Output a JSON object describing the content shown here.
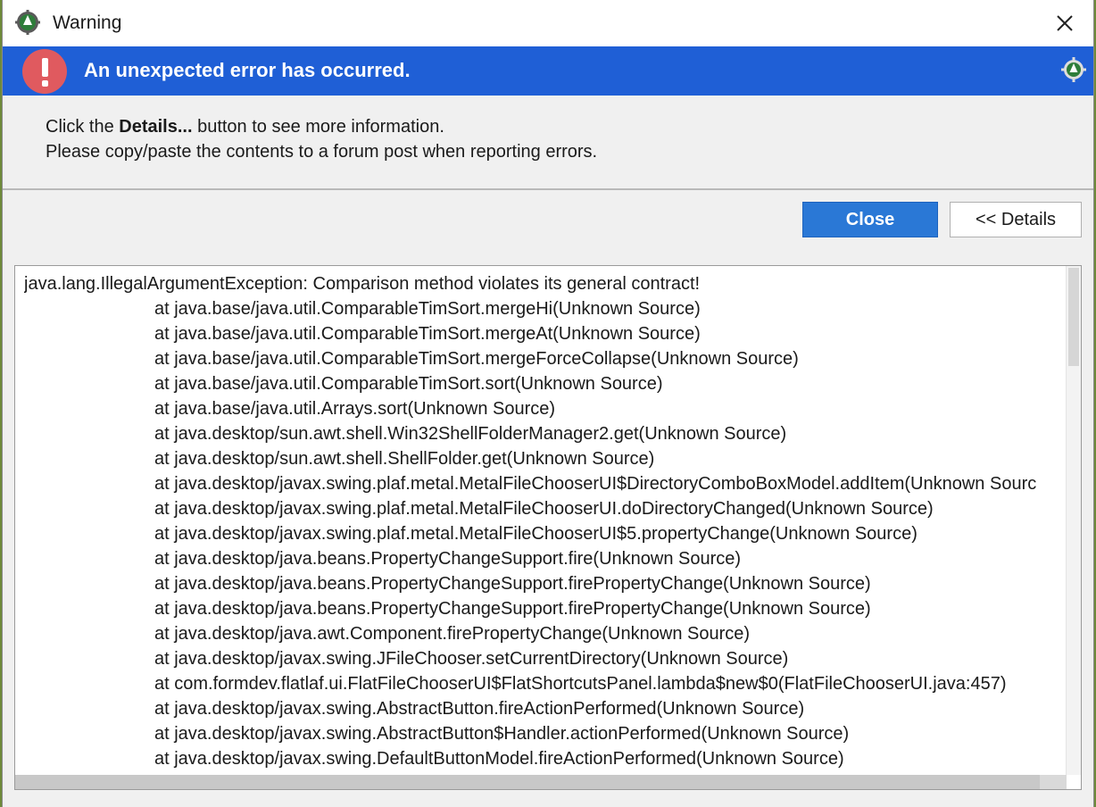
{
  "window": {
    "title": "Warning",
    "app_icon": "eclipse-gear-icon",
    "close_icon": "close-icon"
  },
  "banner": {
    "text": "An unexpected error has occurred.",
    "error_icon": "error-exclamation-icon",
    "gear_icon": "gear-icon",
    "background": "#1f5fd6",
    "icon_color": "#e05a5f"
  },
  "message": {
    "line1_prefix": "Click the ",
    "line1_bold": "Details...",
    "line1_suffix": " button to see more information.",
    "line2": "Please copy/paste the contents to a forum post when reporting errors."
  },
  "buttons": {
    "close_label": "Close",
    "details_label": "<< Details",
    "accent": "#2a78d6"
  },
  "details": {
    "header": "java.lang.IllegalArgumentException: Comparison method violates its general contract!",
    "frames": [
      "at java.base/java.util.ComparableTimSort.mergeHi(Unknown Source)",
      "at java.base/java.util.ComparableTimSort.mergeAt(Unknown Source)",
      "at java.base/java.util.ComparableTimSort.mergeForceCollapse(Unknown Source)",
      "at java.base/java.util.ComparableTimSort.sort(Unknown Source)",
      "at java.base/java.util.Arrays.sort(Unknown Source)",
      "at java.desktop/sun.awt.shell.Win32ShellFolderManager2.get(Unknown Source)",
      "at java.desktop/sun.awt.shell.ShellFolder.get(Unknown Source)",
      "at java.desktop/javax.swing.plaf.metal.MetalFileChooserUI$DirectoryComboBoxModel.addItem(Unknown Sourc",
      "at java.desktop/javax.swing.plaf.metal.MetalFileChooserUI.doDirectoryChanged(Unknown Source)",
      "at java.desktop/javax.swing.plaf.metal.MetalFileChooserUI$5.propertyChange(Unknown Source)",
      "at java.desktop/java.beans.PropertyChangeSupport.fire(Unknown Source)",
      "at java.desktop/java.beans.PropertyChangeSupport.firePropertyChange(Unknown Source)",
      "at java.desktop/java.beans.PropertyChangeSupport.firePropertyChange(Unknown Source)",
      "at java.desktop/java.awt.Component.firePropertyChange(Unknown Source)",
      "at java.desktop/javax.swing.JFileChooser.setCurrentDirectory(Unknown Source)",
      "at com.formdev.flatlaf.ui.FlatFileChooserUI$FlatShortcutsPanel.lambda$new$0(FlatFileChooserUI.java:457)",
      "at java.desktop/javax.swing.AbstractButton.fireActionPerformed(Unknown Source)",
      "at java.desktop/javax.swing.AbstractButton$Handler.actionPerformed(Unknown Source)",
      "at java.desktop/javax.swing.DefaultButtonModel.fireActionPerformed(Unknown Source)"
    ]
  }
}
